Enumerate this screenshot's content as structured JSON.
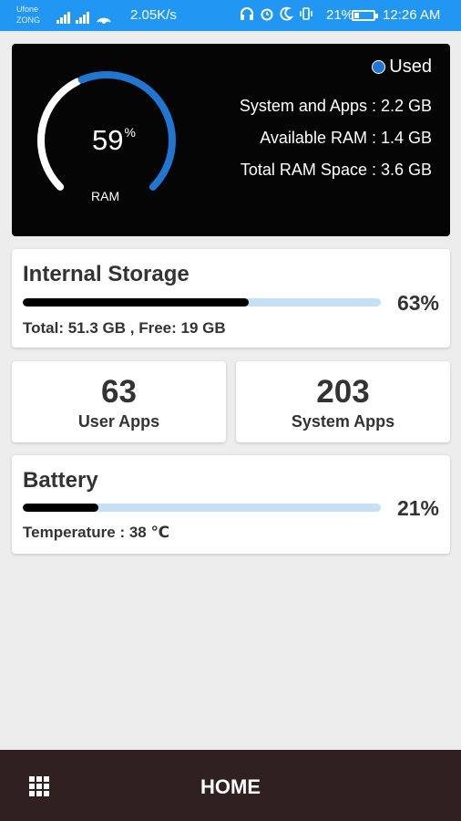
{
  "status_bar": {
    "carrier_1": "Ufone",
    "carrier_2": "ZONG",
    "network_speed": "2.05K/s",
    "battery_percent": "21%",
    "time": "12:26 AM",
    "background_color": "#2196f3",
    "icons": [
      "signal-icon",
      "signal-4g-icon",
      "hotspot-icon",
      "headset-icon",
      "alarm-icon",
      "moon-icon",
      "vibrate-icon",
      "battery-icon"
    ]
  },
  "ram": {
    "used_percent": 59,
    "percent_value": "59",
    "percent_sign": "%",
    "label": "RAM",
    "legend_label": "Used",
    "lines": {
      "system_and_apps": "System and Apps : 2.2 GB",
      "available": "Available RAM : 1.4 GB",
      "total": "Total RAM Space : 3.6 GB"
    },
    "colors": {
      "used": "#2176d2",
      "free": "#ffffff",
      "background": "#050505"
    }
  },
  "storage": {
    "title": "Internal Storage",
    "used_fraction": 0.63,
    "percent_text": "63%",
    "details": "Total:  51.3 GB ,  Free: 19 GB"
  },
  "apps": {
    "user_count": "63",
    "user_label": "User Apps",
    "system_count": "203",
    "system_label": "System Apps"
  },
  "battery": {
    "title": "Battery",
    "level_fraction": 0.21,
    "percent_text": "21%",
    "temperature": "Temperature : 38 ℃"
  },
  "bottom_nav": {
    "menu_icon": "grid-icon",
    "label": "HOME",
    "background_color": "#302020"
  }
}
